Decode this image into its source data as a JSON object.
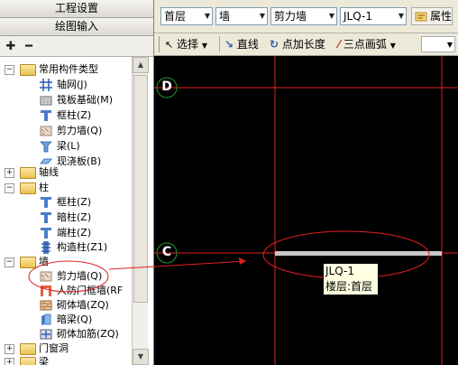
{
  "left_panel": {
    "title_top": "工程设置",
    "title_main": "绘图输入",
    "toolbar": {
      "add_icon": "plus-icon",
      "remove_icon": "minus-icon"
    }
  },
  "tree": {
    "common": {
      "label": "常用构件类型",
      "items": [
        "轴网(J)",
        "筏板基础(M)",
        "框柱(Z)",
        "剪力墙(Q)",
        "梁(L)",
        "现浇板(B)"
      ]
    },
    "axis": {
      "label": "轴线"
    },
    "column": {
      "label": "柱",
      "items": [
        "框柱(Z)",
        "暗柱(Z)",
        "端柱(Z)",
        "构造柱(Z1)"
      ]
    },
    "wall": {
      "label": "墙",
      "items": [
        "剪力墙(Q)",
        "人防门框墙(RF",
        "砌体墙(ZQ)",
        "暗梁(Q)",
        "砌体加筋(ZQ)"
      ]
    },
    "doors": {
      "label": "门窗洞"
    },
    "beam": {
      "label": "梁"
    }
  },
  "toolbar1": {
    "floor": "首层",
    "type": "墙",
    "subtype": "剪力墙",
    "component": "JLQ-1",
    "attr_label": "属性"
  },
  "toolbar2": {
    "select": "选择",
    "line": "直线",
    "point_length": "点加长度",
    "arc": "三点画弧"
  },
  "canvas": {
    "axis_d": "D",
    "axis_c": "C",
    "tooltip_line1": "JLQ-1",
    "tooltip_line2": "楼层:首层"
  },
  "colors": {
    "accent_red": "#e02020",
    "axis_green": "#1f9a2a",
    "canvas_bg": "#000000",
    "wall_fill": "#c8c8c8"
  }
}
